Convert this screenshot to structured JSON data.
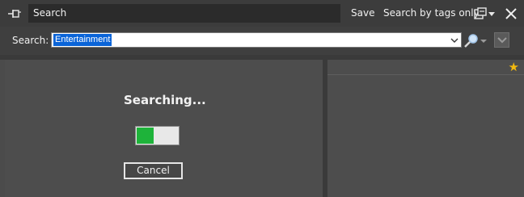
{
  "titlebar": {
    "title": "Search",
    "save_label": "Save",
    "tags_label": "Search by tags only"
  },
  "searchbar": {
    "label": "Search:",
    "value": "Entertainment"
  },
  "status": {
    "text": "Searching...",
    "progress_fraction": 0.42,
    "cancel_label": "Cancel"
  },
  "colors": {
    "progress_fill": "#1eb33a",
    "selection": "#0a64d8",
    "star": "#f2b90f"
  },
  "icons": [
    "pin-icon",
    "options-icon",
    "chevron-down-icon",
    "close-icon",
    "magnifier-icon",
    "star-icon"
  ]
}
